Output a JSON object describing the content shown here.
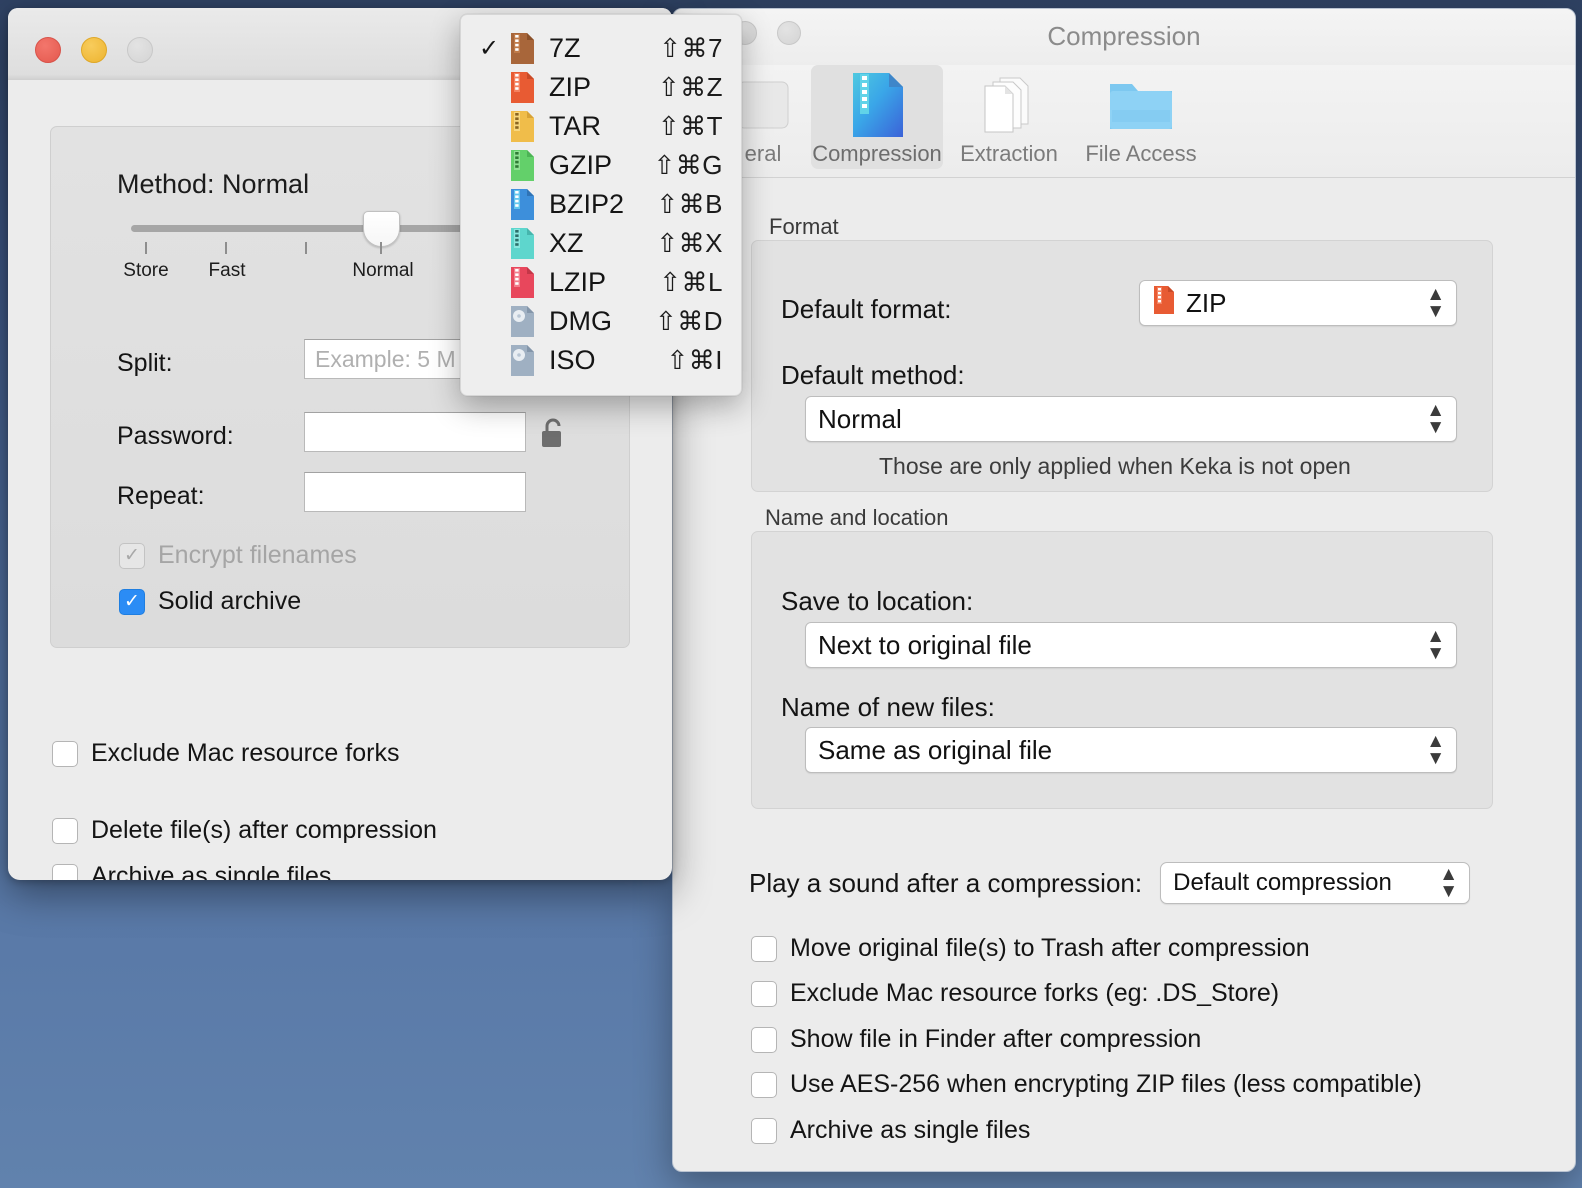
{
  "desktop": {
    "background_top": "#2f4263",
    "background_bottom": "#6182ad"
  },
  "left_window": {
    "traffic_lights": [
      "close",
      "minimize",
      "zoom-disabled"
    ],
    "method": {
      "title": "Method: Normal",
      "value": "Normal",
      "tick_labels": [
        "Store",
        "Fast",
        "Normal"
      ]
    },
    "split": {
      "label": "Split:",
      "value": "",
      "placeholder": "Example: 5 M"
    },
    "password": {
      "label": "Password:",
      "value": "",
      "lock_icon": "unlocked-padlock-icon"
    },
    "repeat": {
      "label": "Repeat:",
      "value": ""
    },
    "checkboxes_inner": [
      {
        "label": "Encrypt filenames",
        "checked": true,
        "disabled": true
      },
      {
        "label": "Solid archive",
        "checked": true,
        "disabled": false
      }
    ],
    "checkboxes_outer": [
      {
        "label": "Exclude Mac resource forks",
        "checked": false
      },
      {
        "label": "Delete file(s) after compression",
        "checked": false
      },
      {
        "label": "Archive as single files",
        "checked": false
      }
    ]
  },
  "format_menu": {
    "checked_index": 0,
    "items": [
      {
        "label": "7Z",
        "shortcut": "⇧⌘7",
        "icon": "archive-file-icon",
        "color": "#a8663a"
      },
      {
        "label": "ZIP",
        "shortcut": "⇧⌘Z",
        "icon": "archive-file-icon",
        "color": "#e85b33"
      },
      {
        "label": "TAR",
        "shortcut": "⇧⌘T",
        "icon": "archive-file-icon",
        "color": "#f0bd4a"
      },
      {
        "label": "GZIP",
        "shortcut": "⇧⌘G",
        "icon": "archive-file-icon",
        "color": "#63d06a"
      },
      {
        "label": "BZIP2",
        "shortcut": "⇧⌘B",
        "icon": "archive-file-icon",
        "color": "#3d8fdb"
      },
      {
        "label": "XZ",
        "shortcut": "⇧⌘X",
        "icon": "archive-file-icon",
        "color": "#5ed6cd"
      },
      {
        "label": "LZIP",
        "shortcut": "⇧⌘L",
        "icon": "archive-file-icon",
        "color": "#e8475c"
      },
      {
        "label": "DMG",
        "shortcut": "⇧⌘D",
        "icon": "disk-image-icon",
        "color": "#9fb0c2"
      },
      {
        "label": "ISO",
        "shortcut": "⇧⌘I",
        "icon": "disk-image-icon",
        "color": "#9fb0c2"
      }
    ]
  },
  "right_window": {
    "title": "Compression",
    "toolbar": [
      {
        "label": "eral",
        "icon": "general-gear-icon",
        "selected": false
      },
      {
        "label": "Compression",
        "icon": "compression-file-icon",
        "selected": true
      },
      {
        "label": "Extraction",
        "icon": "extraction-pages-icon",
        "selected": false
      },
      {
        "label": "File Access",
        "icon": "folder-icon",
        "selected": false
      }
    ],
    "format_section": {
      "title": "Format",
      "default_format_label": "Default format:",
      "default_format_value": "ZIP",
      "default_method_label": "Default method:",
      "default_method_value": "Normal",
      "note": "Those are only applied when Keka is not open"
    },
    "name_location_section": {
      "title": "Name and location",
      "save_to_label": "Save to location:",
      "save_to_value": "Next to original file",
      "name_of_files_label": "Name of new files:",
      "name_of_files_value": "Same as original file"
    },
    "sound": {
      "label": "Play a sound after a compression:",
      "value": "Default compression"
    },
    "checkboxes": [
      {
        "label": "Move original file(s) to Trash after compression",
        "checked": false
      },
      {
        "label": "Exclude Mac resource forks (eg: .DS_Store)",
        "checked": false
      },
      {
        "label": "Show file in Finder after compression",
        "checked": false
      },
      {
        "label": "Use AES-256 when encrypting ZIP files (less compatible)",
        "checked": false
      },
      {
        "label": "Archive as single files",
        "checked": false
      }
    ]
  }
}
